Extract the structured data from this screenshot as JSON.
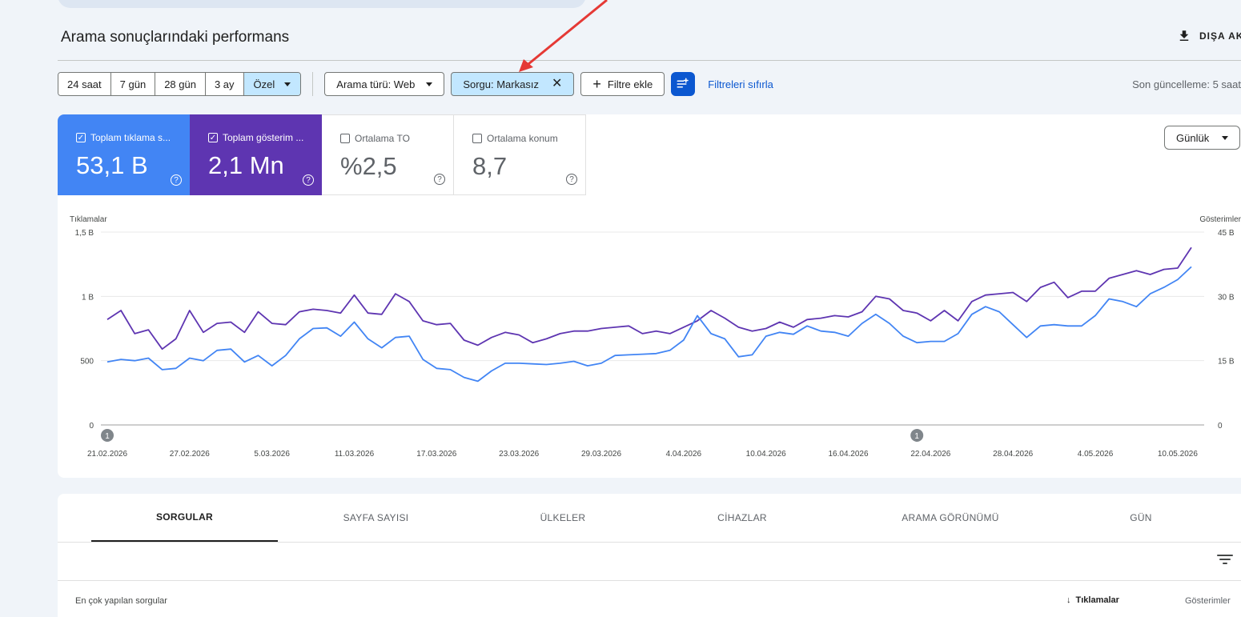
{
  "header": {
    "title": "Arama sonuçlarındaki performans",
    "export_label": "DIŞA AK"
  },
  "filters": {
    "date_ranges": [
      "24 saat",
      "7 gün",
      "28 gün",
      "3 ay",
      "Özel"
    ],
    "search_type": "Arama türü: Web",
    "query_chip": "Sorgu: Markasız",
    "add_filter": "Filtre ekle",
    "reset_filters": "Filtreleri sıfırla",
    "last_update": "Son güncelleme: 5 saat"
  },
  "metrics": [
    {
      "label": "Toplam tıklama s...",
      "value": "53,1 B",
      "checked": true
    },
    {
      "label": "Toplam gösterim ...",
      "value": "2,1 Mn",
      "checked": true
    },
    {
      "label": "Ortalama TO",
      "value": "%2,5",
      "checked": false
    },
    {
      "label": "Ortalama konum",
      "value": "8,7",
      "checked": false
    }
  ],
  "granularity": "Günlük",
  "chart_data": {
    "type": "line",
    "left_axis_label": "Tıklamalar",
    "right_axis_label": "Gösterimler",
    "left_ticks": [
      "0",
      "500",
      "1 B",
      "1,5 B"
    ],
    "right_ticks": [
      "0",
      "15 B",
      "30 B",
      "45 B"
    ],
    "ylim_left": [
      0,
      1500
    ],
    "ylim_right": [
      0,
      45000
    ],
    "x_tick_labels": [
      "21.02.2026",
      "27.02.2026",
      "5.03.2026",
      "11.03.2026",
      "17.03.2026",
      "23.03.2026",
      "29.03.2026",
      "4.04.2026",
      "10.04.2026",
      "16.04.2026",
      "22.04.2026",
      "28.04.2026",
      "4.05.2026",
      "10.05.2026"
    ],
    "annotations": [
      {
        "date_index": 0,
        "label": "1"
      },
      {
        "date_index": 59,
        "label": "1"
      }
    ],
    "colors": {
      "clicks": "#4285f4",
      "impressions": "#5e35b1"
    },
    "series": [
      {
        "name": "Tıklamalar",
        "axis": "left",
        "values": [
          490,
          510,
          500,
          520,
          430,
          440,
          520,
          500,
          580,
          590,
          490,
          540,
          460,
          540,
          670,
          750,
          755,
          690,
          800,
          670,
          600,
          680,
          690,
          510,
          440,
          430,
          370,
          340,
          420,
          480,
          480,
          475,
          470,
          480,
          495,
          460,
          480,
          540,
          545,
          550,
          555,
          580,
          660,
          850,
          710,
          670,
          530,
          545,
          690,
          720,
          705,
          770,
          730,
          720,
          690,
          790,
          860,
          790,
          690,
          640,
          650,
          650,
          710,
          860,
          920,
          880,
          780,
          680,
          770,
          780,
          770,
          770,
          850,
          980,
          960,
          920,
          1020,
          1070,
          1130,
          1230
        ]
      },
      {
        "name": "Gösterimler",
        "axis": "left",
        "values": [
          820,
          890,
          710,
          740,
          590,
          670,
          890,
          720,
          790,
          800,
          720,
          880,
          790,
          780,
          880,
          900,
          890,
          870,
          1010,
          870,
          860,
          1020,
          960,
          810,
          780,
          790,
          660,
          620,
          680,
          720,
          700,
          640,
          670,
          710,
          730,
          730,
          750,
          760,
          770,
          710,
          730,
          710,
          760,
          810,
          890,
          830,
          760,
          730,
          750,
          800,
          760,
          820,
          830,
          850,
          840,
          880,
          1000,
          980,
          890,
          870,
          810,
          890,
          810,
          960,
          1010,
          1020,
          1030,
          960,
          1070,
          1110,
          990,
          1040,
          1040,
          1140,
          1170,
          1200,
          1170,
          1210,
          1220,
          1380
        ]
      }
    ]
  },
  "tabs": [
    "SORGULAR",
    "SAYFA SAYISI",
    "ÜLKELER",
    "CİHAZLAR",
    "ARAMA GÖRÜNÜMÜ",
    "GÜN"
  ],
  "table": {
    "title": "En çok yapılan sorgular",
    "col_clicks": "Tıklamalar",
    "col_impressions": "Gösterimler"
  }
}
